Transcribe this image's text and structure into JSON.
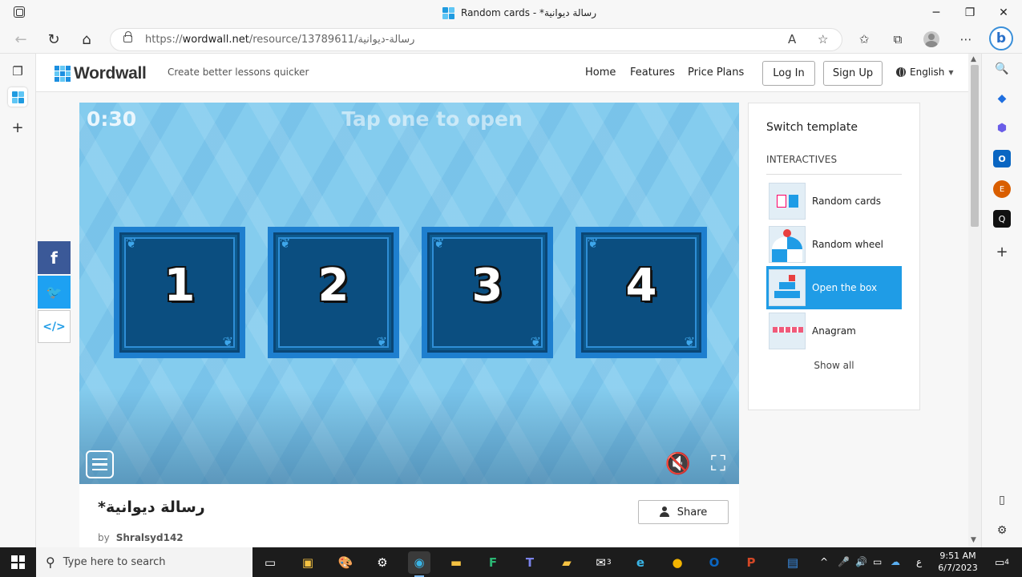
{
  "browser": {
    "tab_title": "Random cards - *رسالة ديوانية",
    "url_prefix": "https://",
    "url_domain": "wordwall.net",
    "url_path": "/resource/13789611/رسالة-ديوانية",
    "min_glyph": "─",
    "max_glyph": "❐",
    "close_glyph": "✕"
  },
  "header": {
    "brand": "Wordwall",
    "tagline": "Create better lessons quicker",
    "nav": [
      "Home",
      "Features",
      "Price Plans"
    ],
    "login": "Log In",
    "signup": "Sign Up",
    "language": "English"
  },
  "game": {
    "timer": "0:30",
    "prompt": "Tap one to open",
    "cards": [
      "1",
      "2",
      "3",
      "4"
    ]
  },
  "templates": {
    "title": "Switch template",
    "section": "INTERACTIVES",
    "items": [
      "Random cards",
      "Random wheel",
      "Open the box",
      "Anagram"
    ],
    "selected": "Open the box",
    "show_all": "Show all"
  },
  "activity": {
    "title": "*رسالة ديوانية",
    "by_label": "by",
    "author": "Shralsyd142",
    "share": "Share"
  },
  "taskbar": {
    "search_placeholder": "Type here to search",
    "time": "9:51 AM",
    "date": "6/7/2023",
    "lang_indicator": "ع",
    "notif_count": "4",
    "mail_badge": "3"
  },
  "colors": {
    "accent": "#1f9ce6",
    "facebook": "#3b5998",
    "twitter": "#1da1f2",
    "game_bg": "#84ccee",
    "card_border": "#1e7fcf"
  }
}
